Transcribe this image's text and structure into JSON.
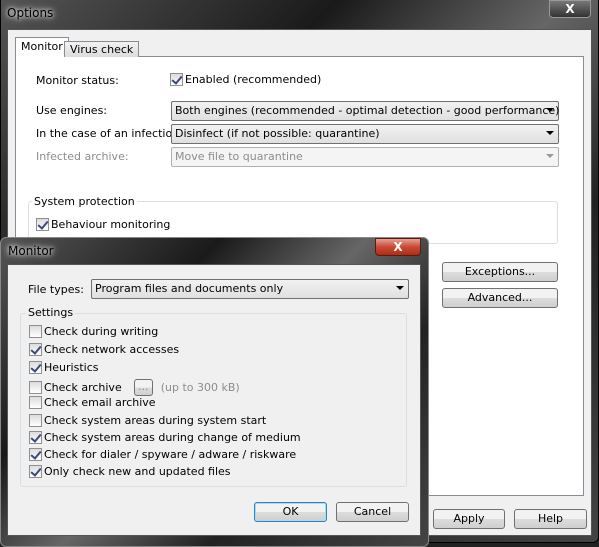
{
  "options": {
    "title": "Options",
    "close": "X",
    "tabs": [
      {
        "label": "Monitor",
        "active": true
      },
      {
        "label": "Virus check",
        "active": false
      }
    ],
    "monitor_status": {
      "label": "Monitor status:",
      "checkbox_label": "Enabled (recommended)",
      "checked": true
    },
    "use_engines": {
      "label": "Use engines:",
      "value": "Both engines (recommended - optimal detection - good performance)"
    },
    "infection": {
      "label": "In the case of an infection:",
      "value": "Disinfect (if not possible: quarantine)"
    },
    "infected_archive": {
      "label": "Infected archive:",
      "value": "Move file to quarantine",
      "disabled": true
    },
    "system_protection": {
      "title": "System protection",
      "behaviour": {
        "label": "Behaviour monitoring",
        "checked": true
      }
    },
    "exceptions_button": "Exceptions...",
    "advanced_button": "Advanced...",
    "apply_button": "Apply",
    "help_button": "Help"
  },
  "monitor": {
    "title": "Monitor",
    "close": "X",
    "file_types": {
      "label": "File types:",
      "value": "Program files and documents only"
    },
    "settings_title": "Settings",
    "settings": [
      {
        "label": "Check during writing",
        "checked": false
      },
      {
        "label": "Check network accesses",
        "checked": true
      },
      {
        "label": "Heuristics",
        "checked": true
      },
      {
        "label": "Check archive",
        "checked": false
      },
      {
        "label": "Check email archive",
        "checked": false
      },
      {
        "label": "Check system areas during system start",
        "checked": false
      },
      {
        "label": "Check system areas during change of medium",
        "checked": true
      },
      {
        "label": "Check for dialer / spyware / adware / riskware",
        "checked": true
      },
      {
        "label": "Only check new and updated files",
        "checked": true
      }
    ],
    "archive_browse": "...",
    "archive_limit": "(up to 300 kB)",
    "ok_button": "OK",
    "cancel_button": "Cancel"
  }
}
